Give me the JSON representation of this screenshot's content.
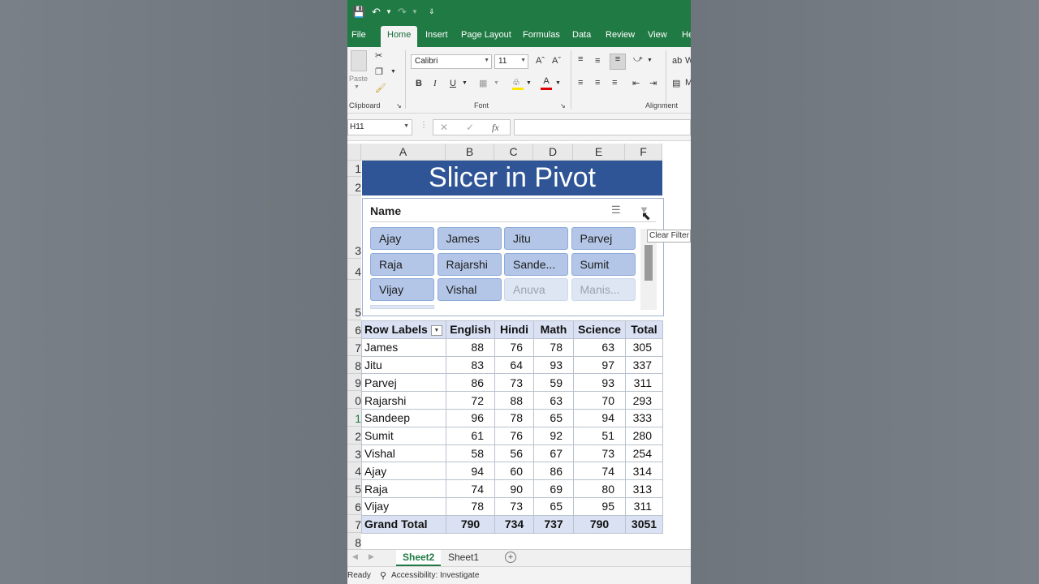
{
  "ribbon_tabs": [
    "File",
    "Home",
    "Insert",
    "Page Layout",
    "Formulas",
    "Data",
    "Review",
    "View",
    "He"
  ],
  "active_tab": "Home",
  "clipboard": {
    "paste_label": "Paste",
    "group_label": "Clipboard"
  },
  "font": {
    "name": "Calibri",
    "size": "11",
    "group_label": "Font"
  },
  "alignment": {
    "group_label": "Alignment",
    "wrap_cut": "W",
    "merge_cut": "M"
  },
  "formula_bar": {
    "name_box": "H11",
    "fx": "fx"
  },
  "columns": [
    "A",
    "B",
    "C",
    "D",
    "E",
    "F"
  ],
  "rows": [
    "1",
    "2",
    "3",
    "4",
    "5",
    "6",
    "7",
    "8",
    "9",
    "0",
    "1",
    "2",
    "3",
    "4",
    "5",
    "6",
    "7",
    "8"
  ],
  "title": "Slicer in Pivot",
  "slicer": {
    "header": "Name",
    "items": [
      {
        "label": "Ajay",
        "selected": true
      },
      {
        "label": "James",
        "selected": true
      },
      {
        "label": "Jitu",
        "selected": true
      },
      {
        "label": "Parvej",
        "selected": true
      },
      {
        "label": "Raja",
        "selected": true
      },
      {
        "label": "Rajarshi",
        "selected": true
      },
      {
        "label": "Sande...",
        "selected": true
      },
      {
        "label": "Sumit",
        "selected": true
      },
      {
        "label": "Vijay",
        "selected": true
      },
      {
        "label": "Vishal",
        "selected": true
      },
      {
        "label": "Anuva",
        "selected": false
      },
      {
        "label": "Manis...",
        "selected": false
      }
    ],
    "tooltip": "Clear Filter"
  },
  "pivot": {
    "headers": [
      "Row Labels",
      "English",
      "Hindi",
      "Math",
      "Science",
      "Total"
    ],
    "rows": [
      [
        "James",
        "88",
        "76",
        "78",
        "63",
        "305"
      ],
      [
        "Jitu",
        "83",
        "64",
        "93",
        "97",
        "337"
      ],
      [
        "Parvej",
        "86",
        "73",
        "59",
        "93",
        "311"
      ],
      [
        "Rajarshi",
        "72",
        "88",
        "63",
        "70",
        "293"
      ],
      [
        "Sandeep",
        "96",
        "78",
        "65",
        "94",
        "333"
      ],
      [
        "Sumit",
        "61",
        "76",
        "92",
        "51",
        "280"
      ],
      [
        "Vishal",
        "58",
        "56",
        "67",
        "73",
        "254"
      ],
      [
        "Ajay",
        "94",
        "60",
        "86",
        "74",
        "314"
      ],
      [
        "Raja",
        "74",
        "90",
        "69",
        "80",
        "313"
      ],
      [
        "Vijay",
        "78",
        "73",
        "65",
        "95",
        "311"
      ]
    ],
    "grand_total": [
      "Grand Total",
      "790",
      "734",
      "737",
      "790",
      "3051"
    ]
  },
  "sheets": [
    "Sheet2",
    "Sheet1"
  ],
  "active_sheet": "Sheet2",
  "status": {
    "ready": "Ready",
    "accessibility": "Accessibility: Investigate"
  },
  "colors": {
    "excel_green": "#1f7a43",
    "title_blue": "#2f5597",
    "slicer_selected": "#b4c6e7",
    "pivot_header": "#d9e1f2"
  }
}
